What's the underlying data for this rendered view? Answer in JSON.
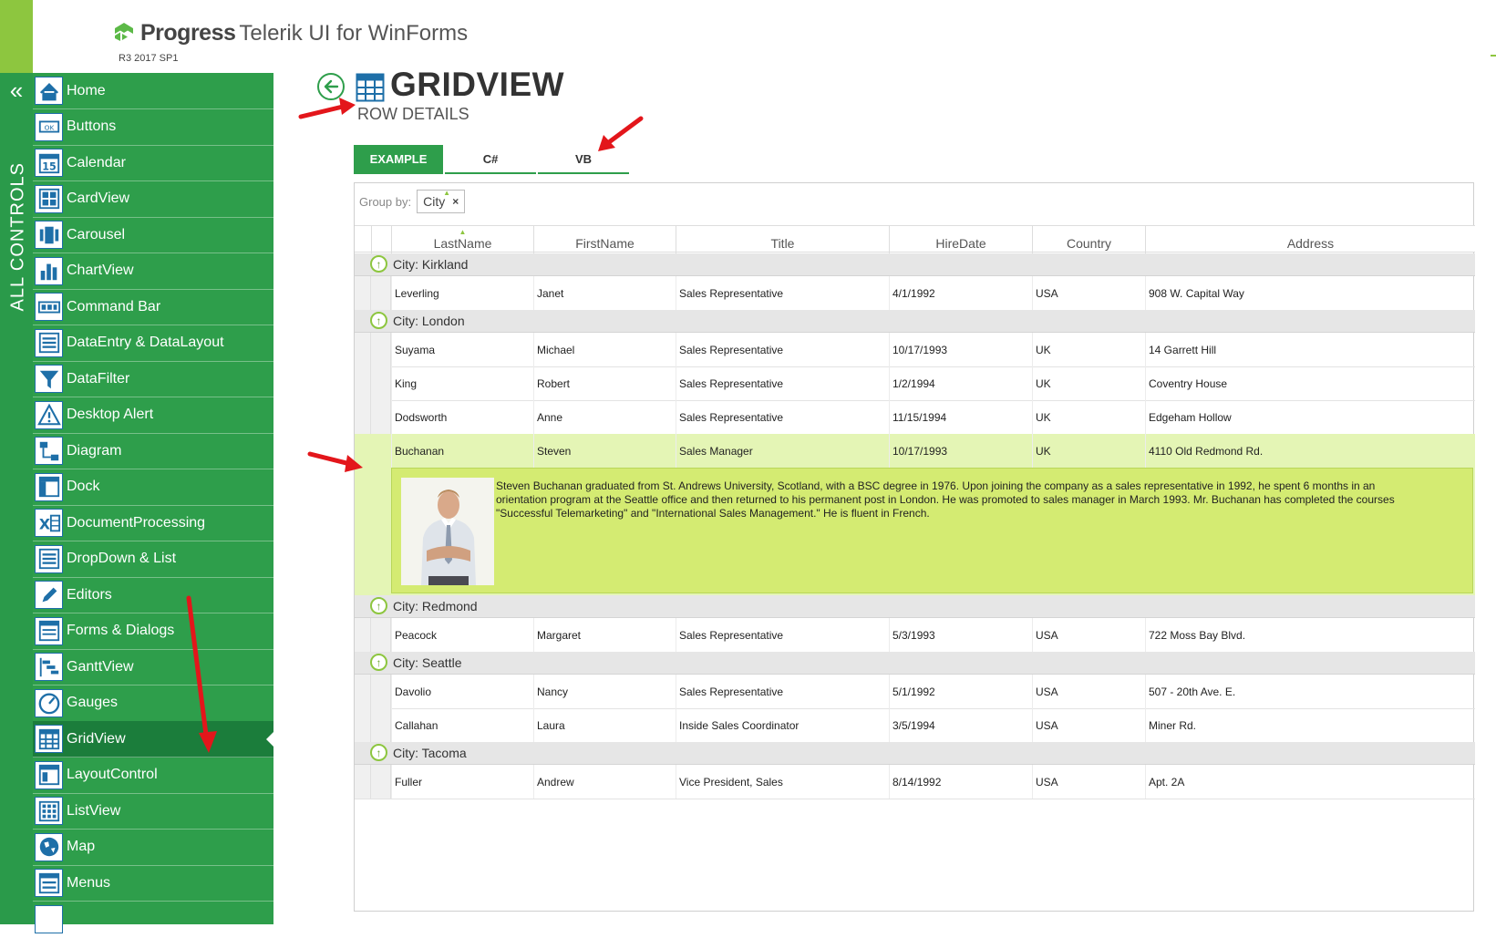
{
  "header": {
    "brand": "Progress",
    "product": "Telerik UI for WinForms",
    "version": "R3 2017 SP1"
  },
  "rail": {
    "collapse_glyph": "«",
    "label": "ALL CONTROLS"
  },
  "nav": {
    "items": [
      {
        "label": "Home",
        "icon": "home-icon"
      },
      {
        "label": "Buttons",
        "icon": "ok-button-icon"
      },
      {
        "label": "Calendar",
        "icon": "calendar-icon"
      },
      {
        "label": "CardView",
        "icon": "cardview-icon"
      },
      {
        "label": "Carousel",
        "icon": "carousel-icon"
      },
      {
        "label": "ChartView",
        "icon": "bar-chart-icon"
      },
      {
        "label": "Command Bar",
        "icon": "command-bar-icon"
      },
      {
        "label": "DataEntry & DataLayout",
        "icon": "data-entry-icon"
      },
      {
        "label": "DataFilter",
        "icon": "filter-icon"
      },
      {
        "label": "Desktop Alert",
        "icon": "alert-icon"
      },
      {
        "label": "Diagram",
        "icon": "diagram-icon"
      },
      {
        "label": "Dock",
        "icon": "dock-icon"
      },
      {
        "label": "DocumentProcessing",
        "icon": "excel-icon"
      },
      {
        "label": "DropDown & List",
        "icon": "list-icon"
      },
      {
        "label": "Editors",
        "icon": "pencil-icon"
      },
      {
        "label": "Forms & Dialogs",
        "icon": "form-icon"
      },
      {
        "label": "GanttView",
        "icon": "gantt-icon"
      },
      {
        "label": "Gauges",
        "icon": "gauge-icon"
      },
      {
        "label": "GridView",
        "icon": "grid-icon"
      },
      {
        "label": "LayoutControl",
        "icon": "layout-icon"
      },
      {
        "label": "ListView",
        "icon": "listview-icon"
      },
      {
        "label": "Map",
        "icon": "globe-icon"
      },
      {
        "label": "Menus",
        "icon": "menu-icon"
      }
    ],
    "active": "GridView",
    "calendar_day": "15",
    "buttons_badge": "OK"
  },
  "page": {
    "title": "GRIDVIEW",
    "subtitle": "ROW DETAILS"
  },
  "tabs": [
    {
      "label": "EXAMPLE",
      "active": true
    },
    {
      "label": "C#",
      "active": false
    },
    {
      "label": "VB",
      "active": false
    }
  ],
  "grid": {
    "group_by_label": "Group by:",
    "group_chip": "City",
    "group_chip_remove": "×",
    "columns": [
      "LastName",
      "FirstName",
      "Title",
      "HireDate",
      "Country",
      "Address"
    ],
    "groups": [
      {
        "label": "City: Kirkland",
        "rows": [
          [
            "Leverling",
            "Janet",
            "Sales Representative",
            "4/1/1992",
            "USA",
            "908 W. Capital Way"
          ]
        ]
      },
      {
        "label": "City: London",
        "rows": [
          [
            "Suyama",
            "Michael",
            "Sales Representative",
            "10/17/1993",
            "UK",
            "14 Garrett Hill"
          ],
          [
            "King",
            "Robert",
            "Sales Representative",
            "1/2/1994",
            "UK",
            "Coventry House"
          ],
          [
            "Dodsworth",
            "Anne",
            "Sales Representative",
            "11/15/1994",
            "UK",
            "Edgeham Hollow"
          ],
          [
            "Buchanan",
            "Steven",
            "Sales Manager",
            "10/17/1993",
            "UK",
            "4110 Old Redmond Rd."
          ]
        ]
      },
      {
        "label": "City: Redmond",
        "rows": [
          [
            "Peacock",
            "Margaret",
            "Sales Representative",
            "5/3/1993",
            "USA",
            "722 Moss Bay Blvd."
          ]
        ]
      },
      {
        "label": "City: Seattle",
        "rows": [
          [
            "Davolio",
            "Nancy",
            "Sales Representative",
            "5/1/1992",
            "USA",
            "507 - 20th Ave. E."
          ],
          [
            "Callahan",
            "Laura",
            "Inside Sales Coordinator",
            "3/5/1994",
            "USA",
            "Miner Rd."
          ]
        ]
      },
      {
        "label": "City: Tacoma",
        "rows": [
          [
            "Fuller",
            "Andrew",
            "Vice President, Sales",
            "8/14/1992",
            "USA",
            "Apt. 2A"
          ]
        ]
      }
    ],
    "selected_row": "Buchanan",
    "details": {
      "bio": "Steven Buchanan graduated from St. Andrews University, Scotland, with a BSC degree in 1976.  Upon joining the company as a sales representative in 1992, he spent 6 months in an orientation program at the Seattle office and then returned to his permanent post in London.  He was promoted to sales manager in March 1993.  Mr. Buchanan has completed the courses \"Successful Telemarketing\" and \"International Sales Management.\"  He is fluent in French."
    }
  },
  "colors": {
    "accent_green": "#2e9e4b",
    "lime": "#8dc63f",
    "selected_row": "#e4f5b5",
    "details_panel": "#d4eb72",
    "annotation_arrow": "#e3161b"
  }
}
